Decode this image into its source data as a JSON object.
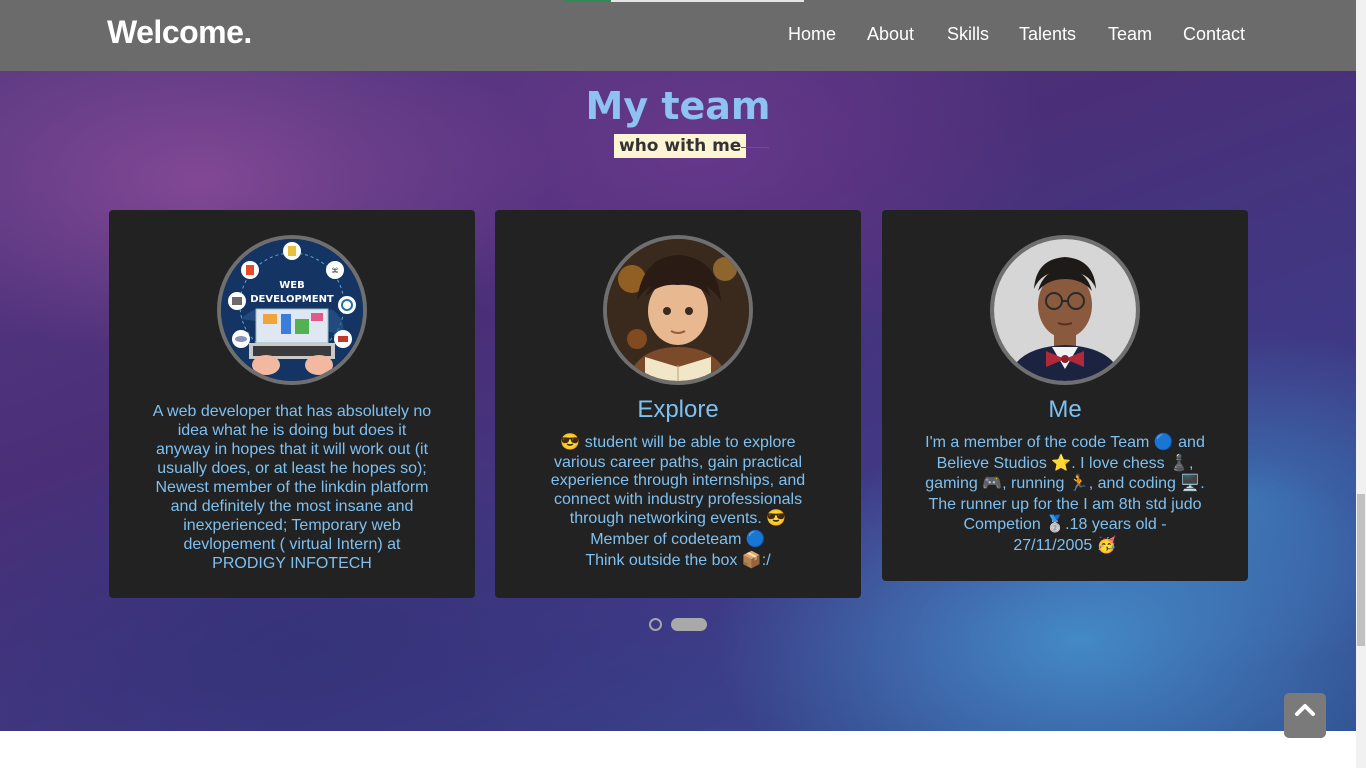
{
  "navbar": {
    "brand": "Welcome.",
    "links": [
      "Home",
      "About",
      "Skills",
      "Talents",
      "Team",
      "Contact"
    ]
  },
  "section": {
    "title": "My team",
    "subtitle": "who with me"
  },
  "cards": [
    {
      "avatar_label": "WEB DEVELOPMENT",
      "name": "",
      "lines": [
        "A web developer that has absolutely no",
        "idea what he is doing but does it",
        "anyway in hopes that it will work out (it",
        "usually does, or at least he hopes so);",
        "Newest member of the linkdin platform",
        "and definitely the most insane and",
        "inexperienced; Temporary web",
        "devlopement ( virtual Intern) at",
        "PRODIGY INFOTECH"
      ]
    },
    {
      "name": "Explore",
      "lines": [
        "😎 student will be able to explore",
        "various career paths, gain practical",
        "experience through internships, and",
        "connect with industry professionals",
        "through networking events. 😎",
        "Member of codeteam 🔵",
        "Think outside the box 📦:/"
      ]
    },
    {
      "name": "Me",
      "lines": [
        "I'm a member of the code Team 🔵 and",
        "Believe Studios ⭐. I love chess ♟️,",
        "gaming 🎮, running 🏃, and coding 🖥️.",
        "The runner up for the I am 8th std judo",
        "Competion 🥈.18 years old -",
        "27/11/2005 🥳"
      ]
    }
  ],
  "carousel": {
    "pages": 2,
    "active_index": 1
  },
  "icons": {
    "back_to_top": "chevron-up-icon"
  },
  "colors": {
    "accent_blue": "#7ec0f0",
    "navbar": "#6b6b6b",
    "card_bg": "#222222",
    "subtitle_bg": "#fdf5d3"
  }
}
